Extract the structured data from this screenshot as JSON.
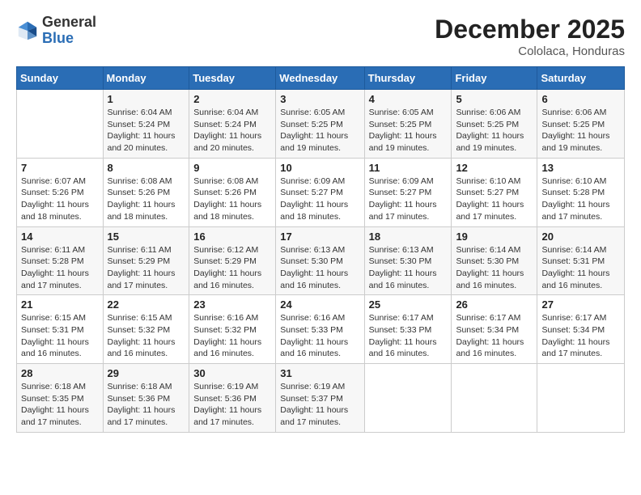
{
  "logo": {
    "general": "General",
    "blue": "Blue"
  },
  "title": "December 2025",
  "subtitle": "Cololaca, Honduras",
  "days_of_week": [
    "Sunday",
    "Monday",
    "Tuesday",
    "Wednesday",
    "Thursday",
    "Friday",
    "Saturday"
  ],
  "weeks": [
    [
      {
        "day": "",
        "sunrise": "",
        "sunset": "",
        "daylight": ""
      },
      {
        "day": "1",
        "sunrise": "Sunrise: 6:04 AM",
        "sunset": "Sunset: 5:24 PM",
        "daylight": "Daylight: 11 hours and 20 minutes."
      },
      {
        "day": "2",
        "sunrise": "Sunrise: 6:04 AM",
        "sunset": "Sunset: 5:24 PM",
        "daylight": "Daylight: 11 hours and 20 minutes."
      },
      {
        "day": "3",
        "sunrise": "Sunrise: 6:05 AM",
        "sunset": "Sunset: 5:25 PM",
        "daylight": "Daylight: 11 hours and 19 minutes."
      },
      {
        "day": "4",
        "sunrise": "Sunrise: 6:05 AM",
        "sunset": "Sunset: 5:25 PM",
        "daylight": "Daylight: 11 hours and 19 minutes."
      },
      {
        "day": "5",
        "sunrise": "Sunrise: 6:06 AM",
        "sunset": "Sunset: 5:25 PM",
        "daylight": "Daylight: 11 hours and 19 minutes."
      },
      {
        "day": "6",
        "sunrise": "Sunrise: 6:06 AM",
        "sunset": "Sunset: 5:25 PM",
        "daylight": "Daylight: 11 hours and 19 minutes."
      }
    ],
    [
      {
        "day": "7",
        "sunrise": "Sunrise: 6:07 AM",
        "sunset": "Sunset: 5:26 PM",
        "daylight": "Daylight: 11 hours and 18 minutes."
      },
      {
        "day": "8",
        "sunrise": "Sunrise: 6:08 AM",
        "sunset": "Sunset: 5:26 PM",
        "daylight": "Daylight: 11 hours and 18 minutes."
      },
      {
        "day": "9",
        "sunrise": "Sunrise: 6:08 AM",
        "sunset": "Sunset: 5:26 PM",
        "daylight": "Daylight: 11 hours and 18 minutes."
      },
      {
        "day": "10",
        "sunrise": "Sunrise: 6:09 AM",
        "sunset": "Sunset: 5:27 PM",
        "daylight": "Daylight: 11 hours and 18 minutes."
      },
      {
        "day": "11",
        "sunrise": "Sunrise: 6:09 AM",
        "sunset": "Sunset: 5:27 PM",
        "daylight": "Daylight: 11 hours and 17 minutes."
      },
      {
        "day": "12",
        "sunrise": "Sunrise: 6:10 AM",
        "sunset": "Sunset: 5:27 PM",
        "daylight": "Daylight: 11 hours and 17 minutes."
      },
      {
        "day": "13",
        "sunrise": "Sunrise: 6:10 AM",
        "sunset": "Sunset: 5:28 PM",
        "daylight": "Daylight: 11 hours and 17 minutes."
      }
    ],
    [
      {
        "day": "14",
        "sunrise": "Sunrise: 6:11 AM",
        "sunset": "Sunset: 5:28 PM",
        "daylight": "Daylight: 11 hours and 17 minutes."
      },
      {
        "day": "15",
        "sunrise": "Sunrise: 6:11 AM",
        "sunset": "Sunset: 5:29 PM",
        "daylight": "Daylight: 11 hours and 17 minutes."
      },
      {
        "day": "16",
        "sunrise": "Sunrise: 6:12 AM",
        "sunset": "Sunset: 5:29 PM",
        "daylight": "Daylight: 11 hours and 16 minutes."
      },
      {
        "day": "17",
        "sunrise": "Sunrise: 6:13 AM",
        "sunset": "Sunset: 5:30 PM",
        "daylight": "Daylight: 11 hours and 16 minutes."
      },
      {
        "day": "18",
        "sunrise": "Sunrise: 6:13 AM",
        "sunset": "Sunset: 5:30 PM",
        "daylight": "Daylight: 11 hours and 16 minutes."
      },
      {
        "day": "19",
        "sunrise": "Sunrise: 6:14 AM",
        "sunset": "Sunset: 5:30 PM",
        "daylight": "Daylight: 11 hours and 16 minutes."
      },
      {
        "day": "20",
        "sunrise": "Sunrise: 6:14 AM",
        "sunset": "Sunset: 5:31 PM",
        "daylight": "Daylight: 11 hours and 16 minutes."
      }
    ],
    [
      {
        "day": "21",
        "sunrise": "Sunrise: 6:15 AM",
        "sunset": "Sunset: 5:31 PM",
        "daylight": "Daylight: 11 hours and 16 minutes."
      },
      {
        "day": "22",
        "sunrise": "Sunrise: 6:15 AM",
        "sunset": "Sunset: 5:32 PM",
        "daylight": "Daylight: 11 hours and 16 minutes."
      },
      {
        "day": "23",
        "sunrise": "Sunrise: 6:16 AM",
        "sunset": "Sunset: 5:32 PM",
        "daylight": "Daylight: 11 hours and 16 minutes."
      },
      {
        "day": "24",
        "sunrise": "Sunrise: 6:16 AM",
        "sunset": "Sunset: 5:33 PM",
        "daylight": "Daylight: 11 hours and 16 minutes."
      },
      {
        "day": "25",
        "sunrise": "Sunrise: 6:17 AM",
        "sunset": "Sunset: 5:33 PM",
        "daylight": "Daylight: 11 hours and 16 minutes."
      },
      {
        "day": "26",
        "sunrise": "Sunrise: 6:17 AM",
        "sunset": "Sunset: 5:34 PM",
        "daylight": "Daylight: 11 hours and 16 minutes."
      },
      {
        "day": "27",
        "sunrise": "Sunrise: 6:17 AM",
        "sunset": "Sunset: 5:34 PM",
        "daylight": "Daylight: 11 hours and 17 minutes."
      }
    ],
    [
      {
        "day": "28",
        "sunrise": "Sunrise: 6:18 AM",
        "sunset": "Sunset: 5:35 PM",
        "daylight": "Daylight: 11 hours and 17 minutes."
      },
      {
        "day": "29",
        "sunrise": "Sunrise: 6:18 AM",
        "sunset": "Sunset: 5:36 PM",
        "daylight": "Daylight: 11 hours and 17 minutes."
      },
      {
        "day": "30",
        "sunrise": "Sunrise: 6:19 AM",
        "sunset": "Sunset: 5:36 PM",
        "daylight": "Daylight: 11 hours and 17 minutes."
      },
      {
        "day": "31",
        "sunrise": "Sunrise: 6:19 AM",
        "sunset": "Sunset: 5:37 PM",
        "daylight": "Daylight: 11 hours and 17 minutes."
      },
      {
        "day": "",
        "sunrise": "",
        "sunset": "",
        "daylight": ""
      },
      {
        "day": "",
        "sunrise": "",
        "sunset": "",
        "daylight": ""
      },
      {
        "day": "",
        "sunrise": "",
        "sunset": "",
        "daylight": ""
      }
    ]
  ]
}
